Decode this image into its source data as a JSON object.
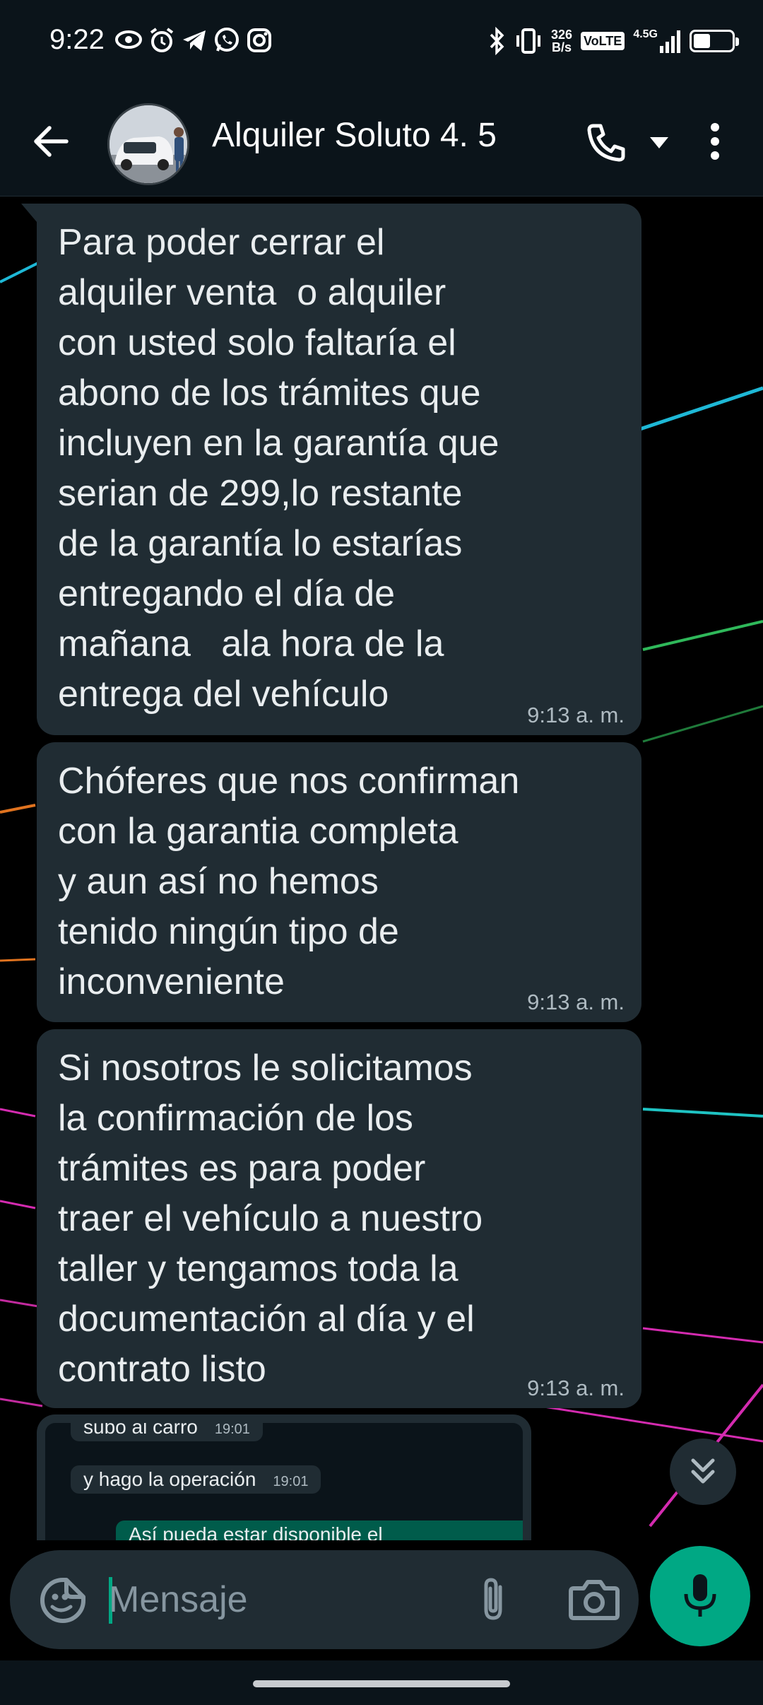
{
  "status_bar": {
    "time": "9:22",
    "left_icons": [
      "eye-icon",
      "alarm-icon",
      "telegram-icon",
      "whatsapp-icon",
      "instagram-icon"
    ],
    "right_icons": [
      "bluetooth-icon",
      "vibrate-icon"
    ],
    "net_speed_value": "326",
    "net_speed_unit": "B/s",
    "volte_label": "VoLTE",
    "network_label": "4.5G",
    "battery_level": 0.45
  },
  "header": {
    "contact_name": "Alquiler Soluto 4. 5",
    "icons": [
      "back-arrow-icon",
      "avatar",
      "phone-icon",
      "chevron-down-icon",
      "more-vert-icon"
    ]
  },
  "messages": [
    {
      "text": "Para poder cerrar el\nalquiler venta  o alquiler\ncon usted solo faltaría el\nabono de los trámites que\nincluyen en la garantía que\nserian de 299,lo restante\nde la garantía lo estarías\nentregando el día de\nmañana   ala hora de la\nentrega del vehículo",
      "time": "9:13 a. m."
    },
    {
      "text": "Chóferes que nos confirman\ncon la garantia completa\ny aun así no hemos\ntenido ningún tipo de\ninconveniente",
      "time": "9:13 a. m."
    },
    {
      "text": "Si nosotros le solicitamos\nla confirmación de los\ntrámites es para poder\ntraer el vehículo a nuestro\ntaller y tengamos toda la\ndocumentación al día y el\ncontrato listo",
      "time": "9:13 a. m."
    }
  ],
  "preview": {
    "messages": [
      {
        "text": "subo al carro",
        "time": "19:01"
      },
      {
        "text": "y hago la operación",
        "time": "19:01"
      }
    ],
    "outgoing_text": "Así pueda estar disponible el"
  },
  "input": {
    "placeholder": "Mensaje"
  },
  "colors": {
    "accent": "#00a884",
    "bubble_incoming": "#202c33",
    "header_bg": "#0b141a"
  }
}
